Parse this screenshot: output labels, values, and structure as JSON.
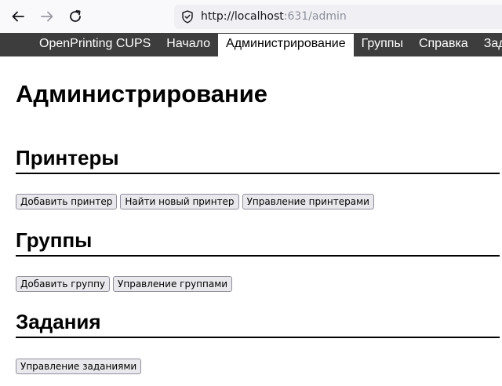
{
  "browser": {
    "url_host": "http://localhost",
    "url_rest": ":631/admin"
  },
  "nav": {
    "items": [
      {
        "label": "OpenPrinting CUPS"
      },
      {
        "label": "Начало"
      },
      {
        "label": "Администрирование",
        "active": true
      },
      {
        "label": "Группы"
      },
      {
        "label": "Справка"
      },
      {
        "label": "Задания"
      }
    ]
  },
  "page": {
    "title": "Администрирование",
    "sections": [
      {
        "heading": "Принтеры",
        "buttons": [
          "Добавить принтер",
          "Найти новый принтер",
          "Управление принтерами"
        ]
      },
      {
        "heading": "Группы",
        "buttons": [
          "Добавить группу",
          "Управление группами"
        ]
      },
      {
        "heading": "Задания",
        "buttons": [
          "Управление заданиями"
        ]
      }
    ]
  }
}
